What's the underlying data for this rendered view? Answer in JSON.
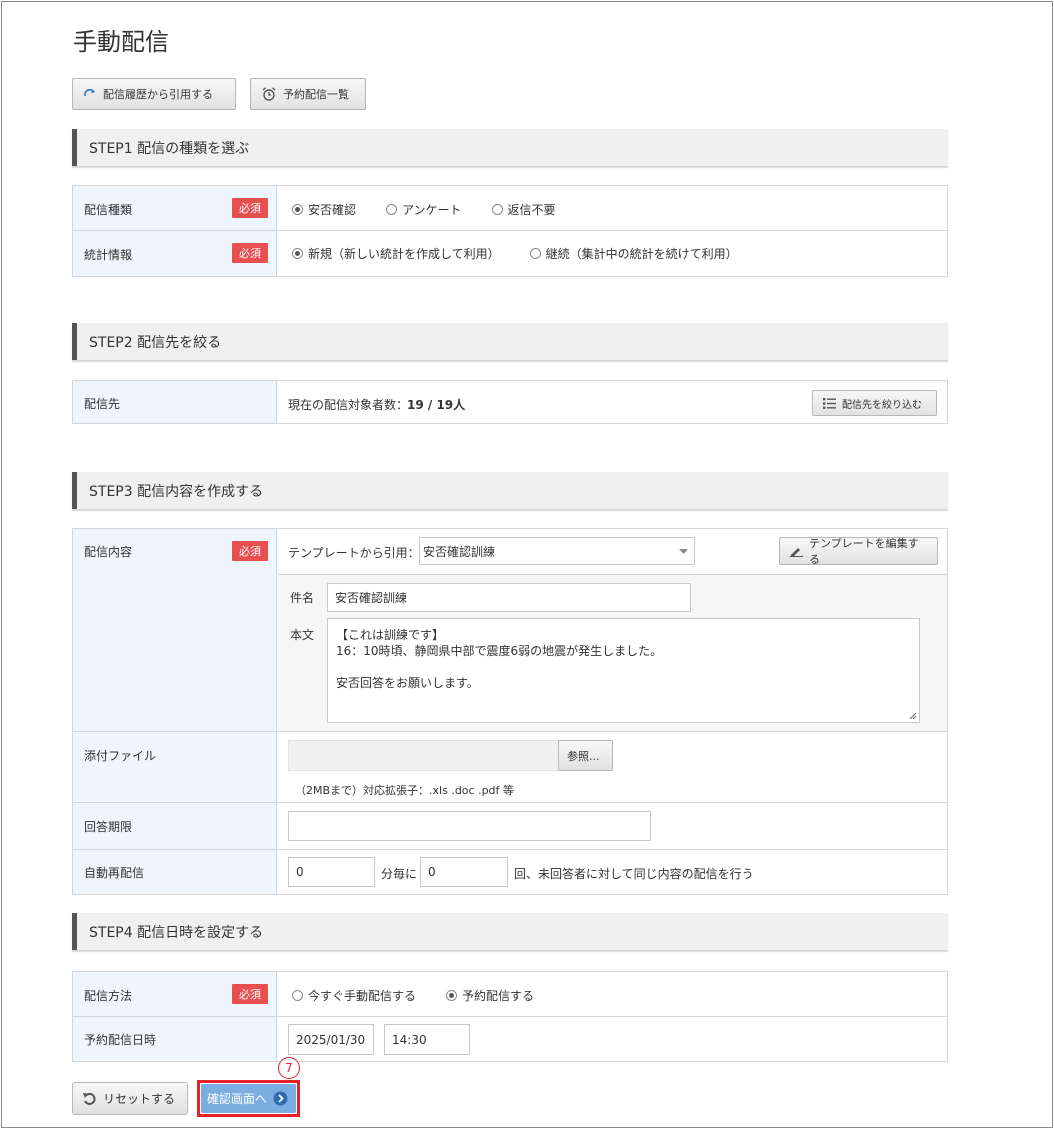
{
  "page_title": "手動配信",
  "toolbar": {
    "history_label": "配信履歴から引用する",
    "reserved_list_label": "予約配信一覧"
  },
  "step1": {
    "title": "STEP1 配信の種類を選ぶ",
    "type_label": "配信種類",
    "stats_label": "統計情報",
    "required": "必須",
    "type_options": [
      "安否確認",
      "アンケート",
      "返信不要"
    ],
    "stats_options": [
      "新規（新しい統計を作成して利用）",
      "継続（集計中の統計を続けて利用）"
    ]
  },
  "step2": {
    "title": "STEP2 配信先を絞る",
    "dest_label": "配信先",
    "count_prefix": "現在の配信対象者数：",
    "count_value": "19 / 19人",
    "filter_button": "配信先を絞り込む"
  },
  "step3": {
    "title": "STEP3 配信内容を作成する",
    "content_label": "配信内容",
    "template_prefix": "テンプレートから引用：",
    "template_value": "安否確認訓練",
    "edit_template_button": "テンプレートを編集する",
    "subject_label": "件名",
    "subject_value": "安否確認訓練",
    "body_label": "本文",
    "body_line1": "【これは訓練です】",
    "body_line2": "16：10時頃、静岡県中部で震度6弱の地震が発生しました。",
    "body_line3": "安否回答をお願いします。",
    "attach_label": "添付ファイル",
    "browse_button": "参照...",
    "attach_note": "（2MBまで）対応拡張子：.xls .doc .pdf 等",
    "deadline_label": "回答期限",
    "resend_label": "自動再配信",
    "resend_interval": "0",
    "resend_interval_suffix": "分毎に",
    "resend_count": "0",
    "resend_count_suffix": "回、未回答者に対して同じ内容の配信を行う"
  },
  "step4": {
    "title": "STEP4 配信日時を設定する",
    "method_label": "配信方法",
    "method_options": [
      "今すぐ手動配信する",
      "予約配信する"
    ],
    "datetime_label": "予約配信日時",
    "date_value": "2025/01/30",
    "time_value": "14:30"
  },
  "footer": {
    "reset_button": "リセットする",
    "confirm_button": "確認画面へ",
    "callout_number": "7"
  },
  "colors": {
    "required_bg": "#e84f4f",
    "label_bg": "#eef5fc",
    "confirm_bg": "#7aaee0",
    "highlight_border": "#e8202a"
  }
}
